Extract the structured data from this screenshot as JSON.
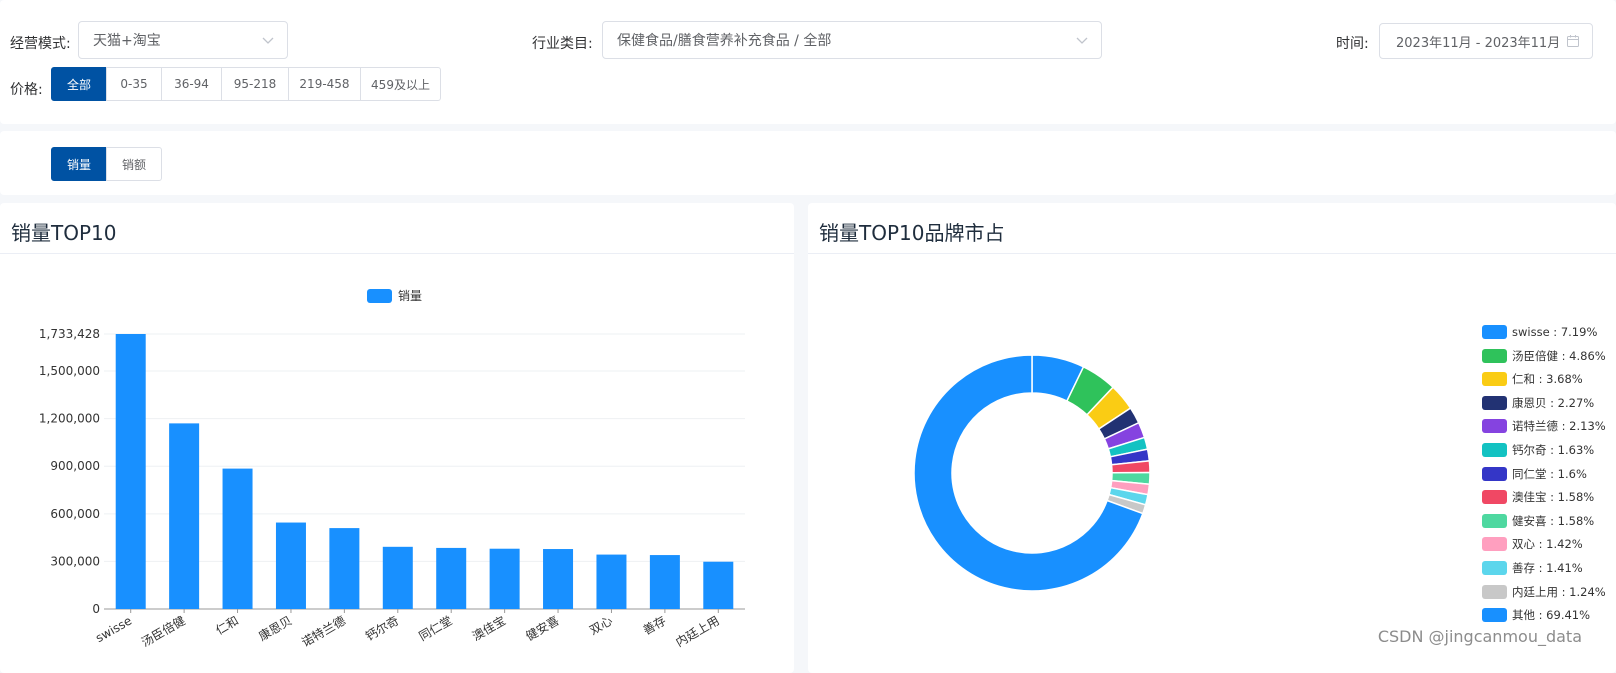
{
  "filters": {
    "mode_label": "经营模式:",
    "mode_value": "天猫+淘宝",
    "category_label": "行业类目:",
    "category_value": "保健食品/膳食营养补充食品 / 全部",
    "time_label": "时间:",
    "time_value": "2023年11月 - 2023年11月",
    "price_label": "价格:",
    "price_options": [
      "全部",
      "0-35",
      "36-94",
      "95-218",
      "219-458",
      "459及以上"
    ],
    "price_selected": "全部"
  },
  "metric_toggle": {
    "options": [
      "销量",
      "销额"
    ],
    "selected": "销量"
  },
  "bar_panel": {
    "title": "销量TOP10"
  },
  "pie_panel": {
    "title": "销量TOP10品牌市占"
  },
  "watermark": "CSDN @jingcanmou_data",
  "colors": {
    "primary": "#0052a3",
    "bar": "#1890ff"
  },
  "chart_data": [
    {
      "type": "bar",
      "legend": [
        "销量"
      ],
      "categories": [
        "swisse",
        "汤臣倍健",
        "仁和",
        "康恩贝",
        "诺特兰德",
        "钙尔奇",
        "同仁堂",
        "澳佳宝",
        "健安喜",
        "双心",
        "善存",
        "内廷上用"
      ],
      "series": [
        {
          "name": "销量",
          "values": [
            1733428,
            1170000,
            885000,
            545000,
            510000,
            392000,
            385000,
            380000,
            378000,
            343000,
            340000,
            298000
          ]
        }
      ],
      "yticks": [
        "0",
        "300,000",
        "600,000",
        "900,000",
        "1,200,000",
        "1,500,000",
        "1,733,428"
      ],
      "ytick_values": [
        0,
        300000,
        600000,
        900000,
        1200000,
        1500000,
        1733428
      ],
      "ylim": [
        0,
        1733428
      ]
    },
    {
      "type": "pie",
      "variant": "donut",
      "labels": [
        "swisse",
        "汤臣倍健",
        "仁和",
        "康恩贝",
        "诺特兰德",
        "钙尔奇",
        "同仁堂",
        "澳佳宝",
        "健安喜",
        "双心",
        "善存",
        "内廷上用",
        "其他"
      ],
      "values": [
        7.19,
        4.86,
        3.68,
        2.27,
        2.13,
        1.63,
        1.6,
        1.58,
        1.58,
        1.42,
        1.41,
        1.24,
        69.41
      ],
      "legend_text": [
        "swisse : 7.19%",
        "汤臣倍健 : 4.86%",
        "仁和 : 3.68%",
        "康恩贝 : 2.27%",
        "诺特兰德 : 2.13%",
        "钙尔奇 : 1.63%",
        "同仁堂 : 1.6%",
        "澳佳宝 : 1.58%",
        "健安喜 : 1.58%",
        "双心 : 1.42%",
        "善存 : 1.41%",
        "内廷上用 : 1.24%",
        "其他 : 69.41%"
      ],
      "colors": [
        "#1890ff",
        "#2fc25b",
        "#facc14",
        "#223273",
        "#8543e0",
        "#13c2c2",
        "#3436c7",
        "#f04864",
        "#4ed8a0",
        "#ff9fbf",
        "#5cd6ec",
        "#c8c8c8",
        "#1890ff"
      ],
      "legend_position": "right"
    }
  ]
}
